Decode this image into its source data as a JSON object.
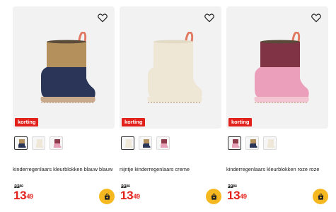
{
  "products": [
    {
      "badge": "korting",
      "title": "kinderregenlaars kleurblokken blauw blauw",
      "old_price_main": "22",
      "old_price_cents": "50",
      "price_main": "13",
      "price_cents": "49",
      "colors": {
        "top": "#b3905c",
        "bottom": "#2b3558",
        "sole": "#c9a98c",
        "pull": "#e07a63"
      },
      "swatches": [
        {
          "top": "#b3905c",
          "bottom": "#2b3558",
          "selected": true
        },
        {
          "top": "#efe8d8",
          "bottom": "#efe8d8",
          "selected": false
        },
        {
          "top": "#8d3b4a",
          "bottom": "#e6a1b8",
          "selected": false
        }
      ]
    },
    {
      "badge": "korting",
      "title": "nijntje kinderregenlaars creme",
      "old_price_main": "22",
      "old_price_cents": "50",
      "price_main": "13",
      "price_cents": "49",
      "colors": {
        "top": "#efe7d6",
        "bottom": "#efe7d6",
        "sole": "#efe7d6",
        "pull": "#e07a63"
      },
      "swatches": [
        {
          "top": "#efe8d8",
          "bottom": "#efe8d8",
          "selected": true
        },
        {
          "top": "#b3905c",
          "bottom": "#2b3558",
          "selected": false
        },
        {
          "top": "#8d3b4a",
          "bottom": "#e6a1b8",
          "selected": false
        }
      ]
    },
    {
      "badge": "korting",
      "title": "kinderregenlaars kleurblokken roze roze",
      "old_price_main": "22",
      "old_price_cents": "50",
      "price_main": "13",
      "price_cents": "49",
      "colors": {
        "top": "#7f3344",
        "bottom": "#eb9fba",
        "sole": "#f3c5d3",
        "pull": "#e07a63"
      },
      "swatches": [
        {
          "top": "#8d3b4a",
          "bottom": "#e6a1b8",
          "selected": true
        },
        {
          "top": "#b3905c",
          "bottom": "#2b3558",
          "selected": false
        },
        {
          "top": "#efe8d8",
          "bottom": "#efe8d8",
          "selected": false
        }
      ]
    }
  ],
  "icons": {
    "wishlist": "heart-outline-icon",
    "cart": "shopping-bag-icon"
  },
  "theme": {
    "accent_red": "#e2211c",
    "cart_yellow": "#f6b820",
    "image_bg": "#f2f2f2"
  }
}
